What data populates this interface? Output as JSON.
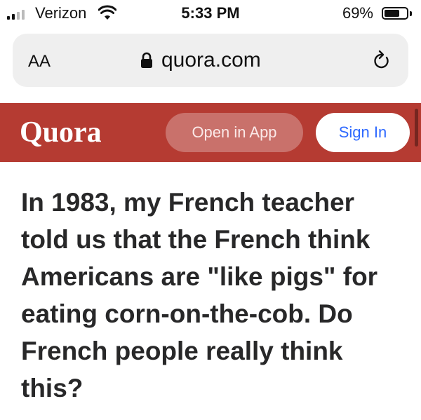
{
  "status_bar": {
    "carrier": "Verizon",
    "time": "5:33 PM",
    "battery_percent": "69%",
    "battery_level": 0.69,
    "signal_bars_active": 2,
    "signal_bars_total": 4,
    "icons": [
      "signal-icon",
      "wifi-icon",
      "battery-icon"
    ]
  },
  "browser": {
    "text_size_button": "AA",
    "url": "quora.com",
    "icons": [
      "lock-icon",
      "reload-icon"
    ]
  },
  "quora_header": {
    "logo": "Quora",
    "open_in_app_label": "Open in App",
    "sign_in_label": "Sign In",
    "colors": {
      "header_bg": "#b53b32",
      "sign_in_text": "#2e69ff"
    }
  },
  "question": {
    "title": "In 1983, my French teacher told us that the French think Americans are \"like pigs\" for eating corn-on-the-cob. Do French people really think this?"
  }
}
